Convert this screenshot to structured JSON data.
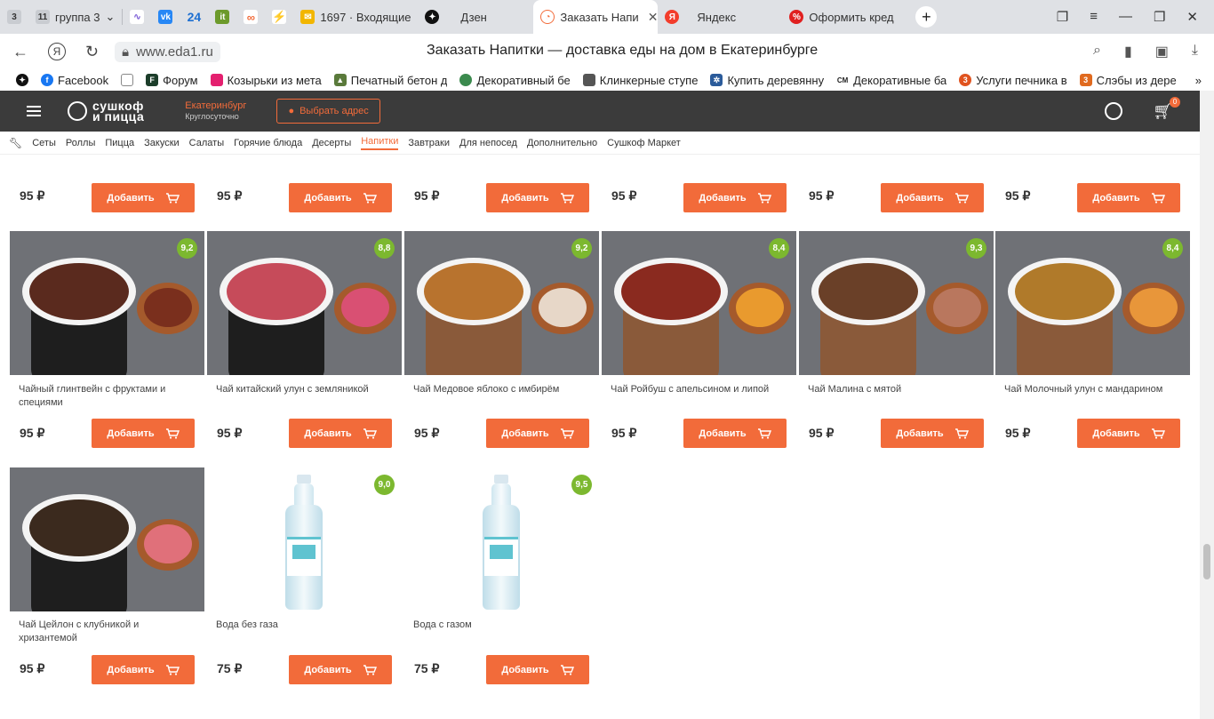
{
  "browser": {
    "tabs": [
      {
        "label": "3",
        "icon": "tab-counter-icon",
        "color": "#9aa0a6"
      },
      {
        "label": "группа 3",
        "count": "11",
        "icon": "group-icon",
        "color": "#9aa0a6"
      },
      {
        "label": "",
        "icon": "chart-icon",
        "color": "#7b5cd6"
      },
      {
        "label": "",
        "icon": "vk-icon",
        "color": "#2787f5"
      },
      {
        "label": "24",
        "icon": "counter-24-icon",
        "color": "#1d6fd1"
      },
      {
        "label": "",
        "icon": "it-icon",
        "color": "#6c9a2b"
      },
      {
        "label": "",
        "icon": "link-icon",
        "color": "#f26b3a"
      },
      {
        "label": "",
        "icon": "flash-icon",
        "color": "#4aa3df"
      },
      {
        "label": "1697 · Входящие",
        "icon": "mail-icon",
        "color": "#f2b600"
      },
      {
        "label": "Дзен",
        "icon": "zen-icon",
        "color": "#111111"
      },
      {
        "label": "Заказать Напи",
        "icon": "eda-icon",
        "color": "#f26b3a",
        "active": true
      },
      {
        "label": "Яндекс",
        "icon": "yandex-icon",
        "color": "#f33d2c"
      },
      {
        "label": "Оформить кред",
        "icon": "credit-icon",
        "color": "#e02020"
      }
    ],
    "url": "www.eda1.ru",
    "page_title": "Заказать Напитки — доставка еды на дом в Екатеринбурге",
    "bookmarks": [
      {
        "label": "Facebook",
        "icon": "facebook-icon",
        "color": "#1877f2"
      },
      {
        "label": "",
        "icon": "document-icon",
        "color": "#888888"
      },
      {
        "label": "Форум",
        "icon": "forum-icon",
        "color": "#1c3d2a"
      },
      {
        "label": "Козырьки из мета",
        "icon": "canopy-icon",
        "color": "#e4206f"
      },
      {
        "label": "Печатный бетон д",
        "icon": "concrete-icon",
        "color": "#5a7a3b"
      },
      {
        "label": "Декоративный бе",
        "icon": "decor-icon",
        "color": "#3b8a4e"
      },
      {
        "label": "Клинкерные ступе",
        "icon": "stairs-icon",
        "color": "#555555"
      },
      {
        "label": "Купить деревянну",
        "icon": "wood-icon",
        "color": "#2b5b9a"
      },
      {
        "label": "Декоративные ба",
        "icon": "cm-icon",
        "color": "#222222"
      },
      {
        "label": "Услуги печника в",
        "icon": "stove-icon",
        "color": "#e0531f"
      },
      {
        "label": "Слэбы из дере",
        "icon": "slab-icon",
        "color": "#e06a1f"
      }
    ]
  },
  "site": {
    "logo_line1": "сушкоф",
    "logo_line2": "и пицца",
    "city": "Екатеринбург",
    "hours": "Круглосуточно",
    "address_button": "Выбрать адрес",
    "cart_count": "0",
    "accent": "#f26b3a",
    "categories": [
      "Сеты",
      "Роллы",
      "Пицца",
      "Закуски",
      "Салаты",
      "Горячие блюда",
      "Десерты",
      "Напитки",
      "Завтраки",
      "Для непосед",
      "Дополнительно",
      "Сушкоф Маркет"
    ],
    "active_category": "Напитки"
  },
  "products": {
    "add_label": "Добавить",
    "row0": [
      {
        "price": "95 ₽"
      },
      {
        "price": "95 ₽"
      },
      {
        "price": "95 ₽"
      },
      {
        "price": "95 ₽"
      },
      {
        "price": "95 ₽"
      },
      {
        "price": "95 ₽"
      }
    ],
    "row1": [
      {
        "name": "Чайный глинтвейн с фруктами и специями",
        "price": "95 ₽",
        "rating": "9,2",
        "tea": "#5a2a1e",
        "plate": "#7a2f1d"
      },
      {
        "name": "Чай китайский улун с земляникой",
        "price": "95 ₽",
        "rating": "8,8",
        "tea": "#c64b5a",
        "plate": "#d95073"
      },
      {
        "name": "Чай Медовое яблоко с имбирём",
        "price": "95 ₽",
        "rating": "9,2",
        "tea": "#b8732e",
        "plate": "#e7d7c8"
      },
      {
        "name": "Чай Ройбуш с апельсином и липой",
        "price": "95 ₽",
        "rating": "8,4",
        "tea": "#8a2a1f",
        "plate": "#e99a2e"
      },
      {
        "name": "Чай Малина с мятой",
        "price": "95 ₽",
        "rating": "9,3",
        "tea": "#6a4028",
        "plate": "#b9775e"
      },
      {
        "name": "Чай Молочный улун с мандарином",
        "price": "95 ₽",
        "rating": "8,4",
        "tea": "#b07a2a",
        "plate": "#e8963a"
      }
    ],
    "row2": [
      {
        "name": "Чай Цейлон с клубникой и хризантемой",
        "price": "95 ₽",
        "rating": "",
        "tea": "#3b2a1e",
        "plate": "#e0707a"
      },
      {
        "name": "Вода без газа",
        "price": "75 ₽",
        "rating": "9,0"
      },
      {
        "name": "Вода с газом",
        "price": "75 ₽",
        "rating": "9,5"
      }
    ]
  }
}
